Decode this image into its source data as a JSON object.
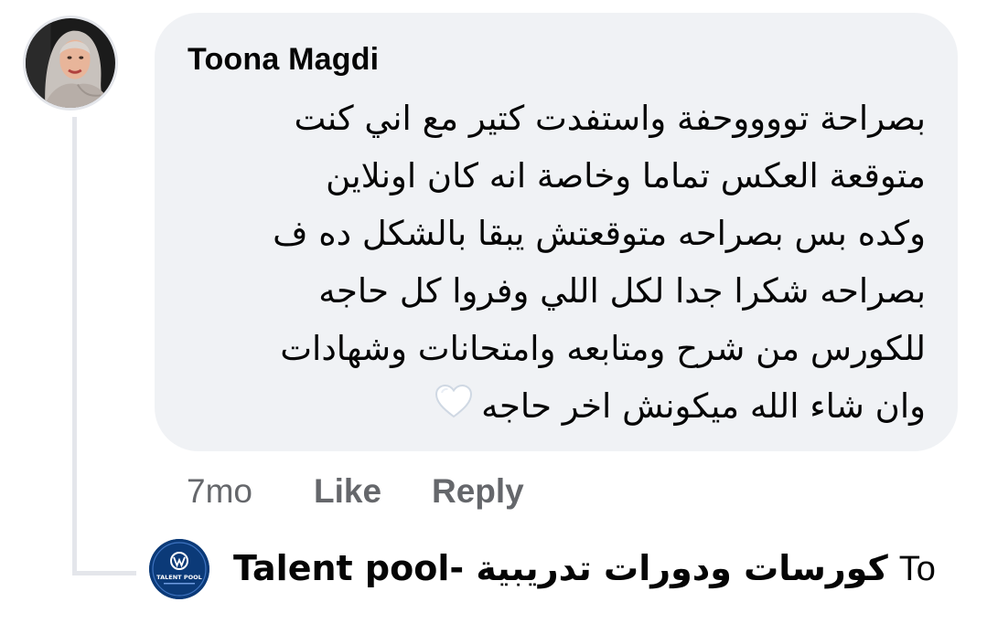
{
  "comment": {
    "author": "Toona Magdi",
    "lines": [
      "بصراحة تووووحفة واستفدت كتير مع اني كنت",
      "متوقعة العكس تماما وخاصة انه كان اونلاين",
      "وكده بس بصراحه متوقعتش يبقا بالشكل ده ف",
      "بصراحه شكرا جدا لكل اللي وفروا كل حاجه",
      "للكورس من شرح ومتابعه وامتحانات وشهادات",
      "وان شاء الله ميكونش اخر حاجه"
    ],
    "emoji": "white-heart-icon"
  },
  "actions": {
    "time": "7mo",
    "like": "Like",
    "reply": "Reply"
  },
  "reply_preview": {
    "page_name": "Talent pool- كورسات ودورات تدريبية",
    "snippet": "To",
    "avatar_text": "TALENT POOL"
  },
  "colors": {
    "bubble": "#f0f2f5",
    "thread_line": "#e4e6eb",
    "action_text": "#65676b",
    "text": "#050505",
    "page_avatar": "#0b3a78"
  }
}
